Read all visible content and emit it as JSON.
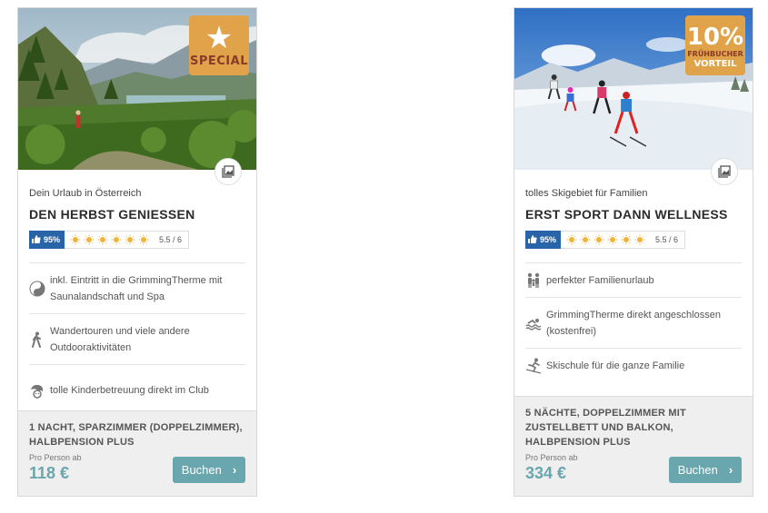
{
  "cards": [
    {
      "badge": {
        "type": "special",
        "label": "SPECIAL",
        "icon": "star-icon"
      },
      "subtitle": "Dein Urlaub in Österreich",
      "title": "DEN HERBST GENIESSEN",
      "rating": {
        "percent": "95%",
        "suns": 6,
        "score": "5.5 / 6"
      },
      "features": [
        {
          "icon": "yin-yang-icon",
          "text": "inkl. Eintritt in die GrimmingTherme mit Saunalandschaft und Spa"
        },
        {
          "icon": "hiker-icon",
          "text": "Wandertouren und viele andere Outdooraktivitäten"
        },
        {
          "icon": "kids-icon",
          "text": "tolle Kinderbetreuung direkt im Club"
        }
      ],
      "room": "1 NACHT, SPARZIMMER (DOPPELZIMMER), HALBPENSION PLUS",
      "price_label": "Pro Person ab",
      "price": "118 €",
      "button": "Buchen"
    },
    {
      "badge": {
        "type": "discount",
        "percent": "10%",
        "line1": "FRÜHBUCHER",
        "line2": "VORTEIL"
      },
      "subtitle": "tolles Skigebiet für Familien",
      "title": "ERST SPORT DANN WELLNESS",
      "rating": {
        "percent": "95%",
        "suns": 6,
        "score": "5.5 / 6"
      },
      "features": [
        {
          "icon": "family-icon",
          "text": "perfekter Familienurlaub"
        },
        {
          "icon": "swimming-icon",
          "text": "GrimmingTherme direkt angeschlossen (kostenfrei)"
        },
        {
          "icon": "skier-icon",
          "text": "Skischule für die ganze Familie"
        }
      ],
      "room": "5 NÄCHTE, DOPPELZIMMER MIT ZUSTELLBETT UND BALKON, HALBPENSION PLUS",
      "price_label": "Pro Person ab",
      "price": "334 €",
      "button": "Buchen"
    }
  ],
  "colors": {
    "badge": "#e1a349",
    "accent": "#6aa6ad",
    "rating_blue": "#2a64a8",
    "sun": "#f0b43a"
  }
}
